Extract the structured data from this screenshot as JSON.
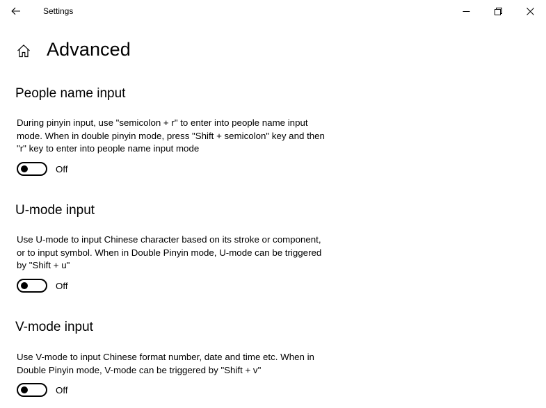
{
  "window": {
    "title": "Settings"
  },
  "page": {
    "title": "Advanced"
  },
  "sections": [
    {
      "title": "People name input",
      "description": "During pinyin input, use \"semicolon + r\" to enter into people name input mode. When in double pinyin mode, press \"Shift + semicolon\" key and then \"r\" key to enter into people name input mode",
      "toggle_state": "Off"
    },
    {
      "title": "U-mode input",
      "description": "Use U-mode to input Chinese character based on its stroke or component, or to input symbol. When in Double Pinyin mode, U-mode can be triggered by \"Shift + u\"",
      "toggle_state": "Off"
    },
    {
      "title": "V-mode input",
      "description": "Use V-mode to input Chinese format number, date and time etc. When in Double Pinyin mode, V-mode can be triggered by \"Shift + v\"",
      "toggle_state": "Off"
    }
  ],
  "icons": {
    "back": "back-arrow-icon",
    "minimize": "minimize-icon",
    "restore": "restore-icon",
    "close": "close-icon",
    "home": "home-icon"
  }
}
